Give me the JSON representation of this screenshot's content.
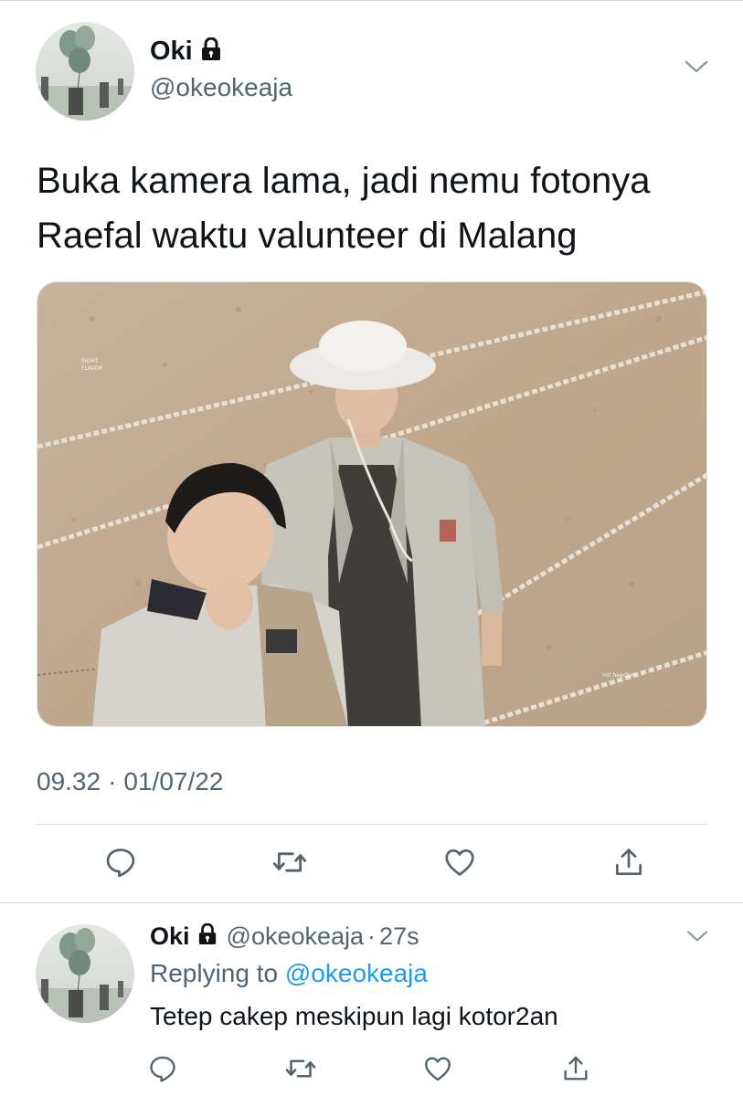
{
  "main_tweet": {
    "display_name": "Oki",
    "handle": "@okeokeaja",
    "text": "Buka kamera lama, jadi nemu fotonya Raefal waktu valunteer di Malang",
    "time": "09.32",
    "date": "01/07/22",
    "meta_separator": "·",
    "photo_watermarks": [
      "EIGHT FLAVOR",
      "nct haechan"
    ],
    "actions": [
      "reply-icon",
      "retweet-icon",
      "like-icon",
      "share-icon"
    ]
  },
  "reply_tweet": {
    "display_name": "Oki",
    "handle": "@okeokeaja",
    "separator": "·",
    "time_ago": "27s",
    "replying_to_prefix": "Replying to",
    "replying_to_handle": "@okeokeaja",
    "text": "Tetep cakep meskipun lagi kotor2an",
    "actions": [
      "reply-icon",
      "retweet-icon",
      "like-icon",
      "share-icon"
    ]
  },
  "colors": {
    "text_primary": "#0f1419",
    "text_secondary": "#536471",
    "link": "#1d9bf0",
    "divider": "#cfd9de"
  },
  "icons": {
    "protected": "lock-icon",
    "menu": "chevron-down-icon"
  }
}
